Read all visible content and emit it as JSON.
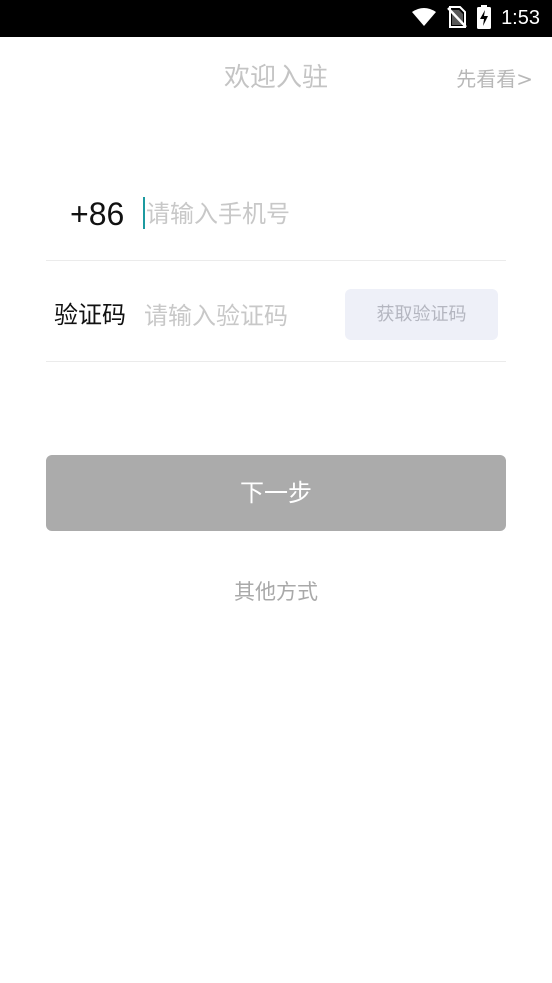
{
  "status_bar": {
    "time": "1:53",
    "icons": [
      "wifi-icon",
      "no-sim-icon",
      "battery-charging-icon"
    ]
  },
  "header": {
    "title": "欢迎入驻",
    "skip_label": "先看看>"
  },
  "form": {
    "country_code": "+86",
    "phone_placeholder": "请输入手机号",
    "phone_value": "",
    "code_label": "验证码",
    "code_placeholder": "请输入验证码",
    "code_value": "",
    "get_code_label": "获取验证码"
  },
  "actions": {
    "next_label": "下一步",
    "other_methods_label": "其他方式"
  },
  "colors": {
    "cursor": "#1c9aa0",
    "next_button": "#ababab",
    "get_code_button_bg": "#eef0f8"
  }
}
